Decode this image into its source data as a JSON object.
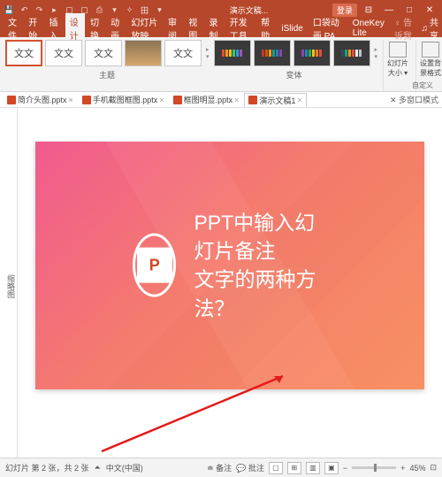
{
  "titlebar": {
    "doc_title": "演示文稿...",
    "login": "登录"
  },
  "tabs": {
    "file": "文件",
    "home": "开始",
    "insert": "插入",
    "design": "设计",
    "transitions": "切换",
    "animations": "动画",
    "slideshow": "幻灯片放映",
    "review": "审阅",
    "view": "视图",
    "record": "录制",
    "dev": "开发工具",
    "help": "帮助",
    "islide": "iSlide",
    "koudai": "口袋动画 PA",
    "onekey": "OneKey Lite",
    "tell": "♀ 告诉我",
    "share": "共享"
  },
  "ribbon": {
    "aa": "文文",
    "themes_label": "主题",
    "variants_label": "变体",
    "size_label": "幻灯片\n大小 ▾",
    "format_label": "设置背\n景格式",
    "custom_label": "自定义"
  },
  "variant_colors": [
    [
      "#e74c3c",
      "#f39c12",
      "#f1c40f",
      "#2ecc71",
      "#3498db",
      "#9b59b6"
    ],
    [
      "#c0392b",
      "#d35400",
      "#f39c12",
      "#16a085",
      "#2980b9",
      "#8e44ad"
    ],
    [
      "#8e44ad",
      "#2980b9",
      "#27ae60",
      "#f1c40f",
      "#e67e22",
      "#e74c3c"
    ],
    [
      "#34495e",
      "#16a085",
      "#f39c12",
      "#e74c3c",
      "#ecf0f1",
      "#bdc3c7"
    ]
  ],
  "files": {
    "items": [
      {
        "name": "简介头图.pptx"
      },
      {
        "name": "手机截图框图.pptx"
      },
      {
        "name": "框图明显.pptx"
      },
      {
        "name": "演示文稿1"
      }
    ],
    "right": "✕ 多窗口模式"
  },
  "leftbar": {
    "label": "缩略图"
  },
  "slide": {
    "badge_letter": "P",
    "line1": "PPT中输入幻灯片备注",
    "line2": "文字的两种方法？"
  },
  "status": {
    "left": "幻灯片 第 2 张，共 2 张",
    "lang": "中文(中国)",
    "notes": "备注",
    "comments": "批注",
    "zoom": "45%"
  }
}
